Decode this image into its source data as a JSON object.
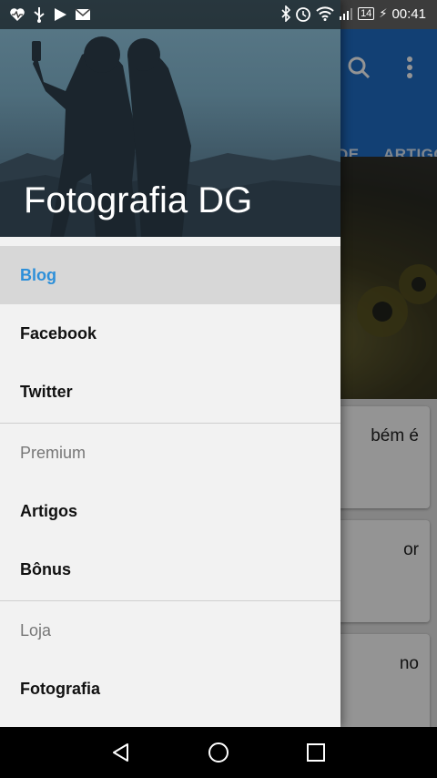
{
  "status_bar": {
    "left_icons": [
      "heart-pulse-icon",
      "usb-icon",
      "play-store-icon",
      "gmail-icon"
    ],
    "right_icons": [
      "bluetooth-icon",
      "alarm-icon",
      "wifi-icon",
      "signal-icon"
    ],
    "battery": "14",
    "time": "00:41"
  },
  "app": {
    "tabs": [
      "DE",
      "ARTIGO"
    ],
    "cards": [
      "bém é",
      "or",
      "no"
    ],
    "toolbar_icons": [
      "search-icon",
      "more-vert-icon"
    ]
  },
  "drawer": {
    "title": "Fotografia DG",
    "items": [
      {
        "label": "Blog",
        "selected": true
      },
      {
        "label": "Facebook"
      },
      {
        "label": "Twitter"
      }
    ],
    "sections": [
      {
        "header": "Premium",
        "items": [
          {
            "label": "Artigos"
          },
          {
            "label": "Bônus"
          }
        ]
      },
      {
        "header": "Loja",
        "items": [
          {
            "label": "Fotografia"
          }
        ]
      }
    ]
  },
  "nav_bar": [
    "back-icon",
    "home-icon",
    "recents-icon"
  ],
  "colors": {
    "accent": "#2c8fd9",
    "app_bar": "#1f6fc9",
    "drawer_bg": "#f2f2f2",
    "selected_bg": "#d7d7d7"
  }
}
